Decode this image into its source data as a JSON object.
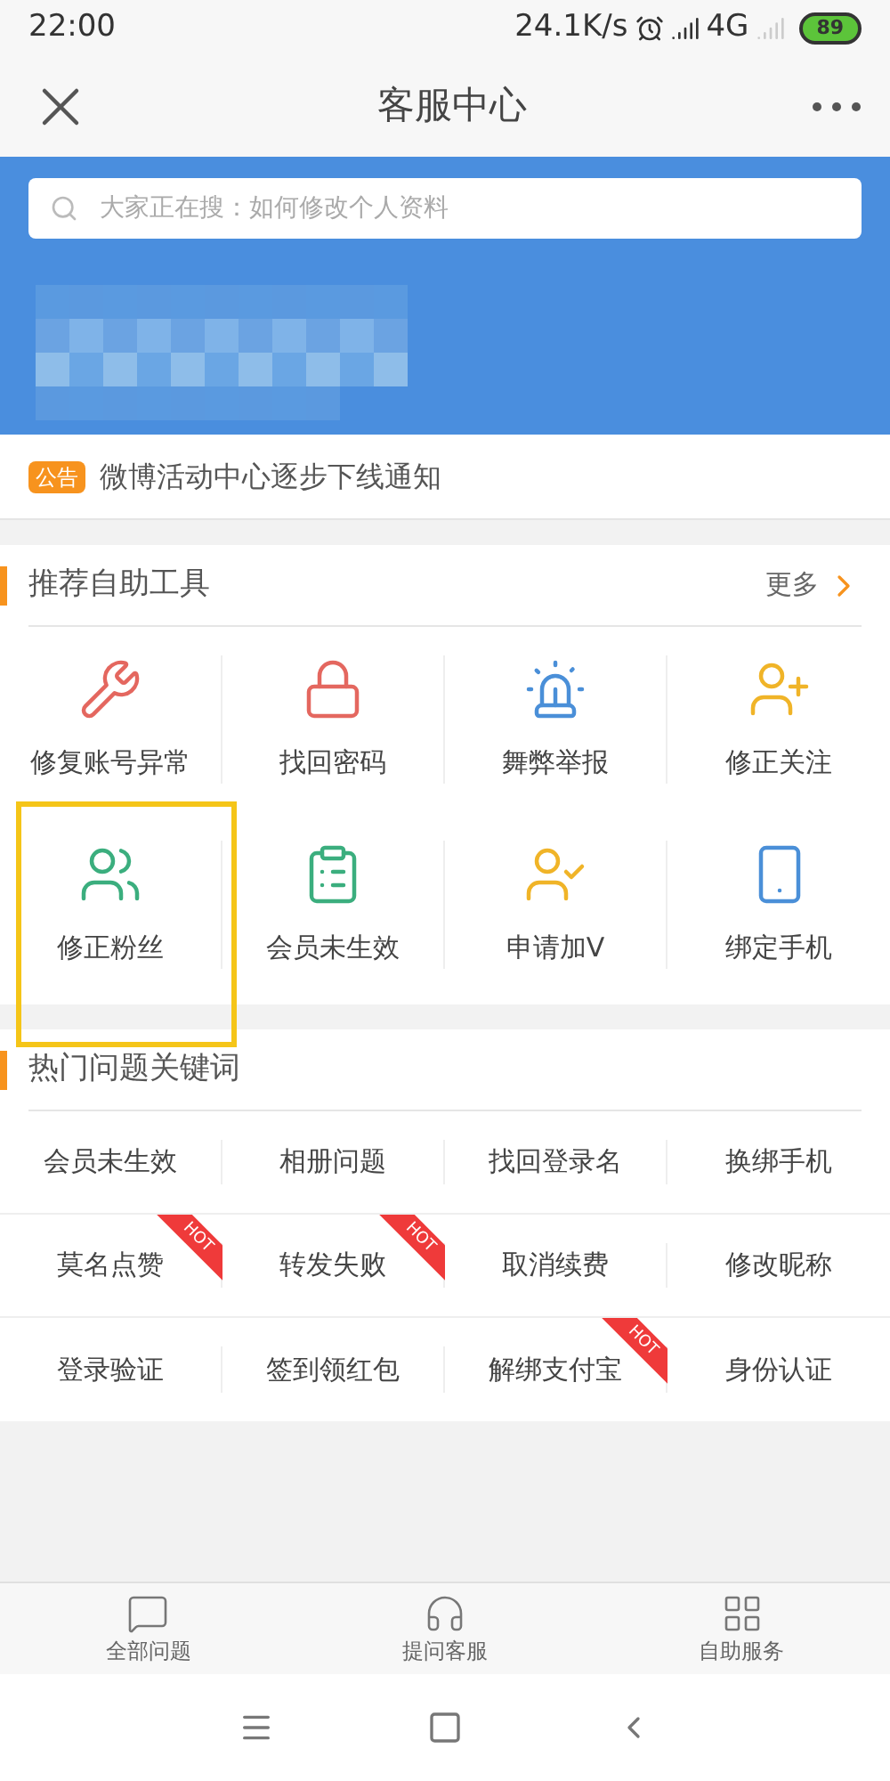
{
  "status_bar": {
    "time": "22:00",
    "speed": "24.1K/s",
    "network": "4G",
    "battery": "89"
  },
  "header": {
    "title": "客服中心"
  },
  "search": {
    "placeholder": "大家正在搜：如何修改个人资料"
  },
  "notice": {
    "badge": "公告",
    "text": "微博活动中心逐步下线通知"
  },
  "tools": {
    "title": "推荐自助工具",
    "more": "更多",
    "items": [
      {
        "label": "修复账号异常",
        "highlighted": false
      },
      {
        "label": "找回密码",
        "highlighted": false
      },
      {
        "label": "舞弊举报",
        "highlighted": false
      },
      {
        "label": "修正关注",
        "highlighted": false
      },
      {
        "label": "修正粉丝",
        "highlighted": true
      },
      {
        "label": "会员未生效",
        "highlighted": false
      },
      {
        "label": "申请加V",
        "highlighted": false
      },
      {
        "label": "绑定手机",
        "highlighted": false
      }
    ]
  },
  "keywords": {
    "title": "热门问题关键词",
    "items": [
      {
        "label": "会员未生效"
      },
      {
        "label": "相册问题"
      },
      {
        "label": "找回登录名"
      },
      {
        "label": "换绑手机"
      },
      {
        "label": "莫名点赞",
        "badge": "HOT"
      },
      {
        "label": "转发失败",
        "badge": "HOT"
      },
      {
        "label": "取消续费"
      },
      {
        "label": "修改昵称"
      },
      {
        "label": "登录验证"
      },
      {
        "label": "签到领红包"
      },
      {
        "label": "解绑支付宝",
        "badge": "HOT"
      },
      {
        "label": "身份认证"
      }
    ]
  },
  "bottom_tabs": [
    {
      "label": "全部问题"
    },
    {
      "label": "提问客服"
    },
    {
      "label": "自助服务"
    }
  ]
}
